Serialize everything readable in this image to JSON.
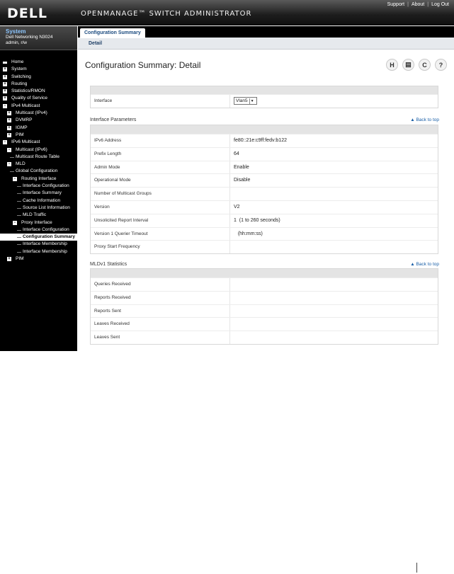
{
  "header": {
    "logo": "DELL",
    "product_title": "OPENMANAGE™ SWITCH ADMINISTRATOR",
    "links": [
      "Support",
      "About",
      "Log Out"
    ],
    "separator": "|"
  },
  "system": {
    "title": "System",
    "device": "Dell Networking N3024",
    "user": "admin, r/w"
  },
  "tree": [
    {
      "label": "Home",
      "level": 0,
      "expander": "",
      "icon": "home-icon"
    },
    {
      "label": "System",
      "level": 0,
      "expander": "+"
    },
    {
      "label": "Switching",
      "level": 0,
      "expander": "+"
    },
    {
      "label": "Routing",
      "level": 0,
      "expander": "+"
    },
    {
      "label": "Statistics/RMON",
      "level": 0,
      "expander": "+"
    },
    {
      "label": "Quality of Service",
      "level": 0,
      "expander": "+"
    },
    {
      "label": "IPv4 Multicast",
      "level": 0,
      "expander": "-"
    },
    {
      "label": "Multicast (IPv4)",
      "level": 1,
      "expander": "+"
    },
    {
      "label": "DVMRP",
      "level": 1,
      "expander": "+"
    },
    {
      "label": "IGMP",
      "level": 1,
      "expander": "+"
    },
    {
      "label": "PIM",
      "level": 1,
      "expander": "+"
    },
    {
      "label": "IPv6 Multicast",
      "level": 0,
      "expander": "-"
    },
    {
      "label": "Multicast (IPv6)",
      "level": 1,
      "expander": "-"
    },
    {
      "label": "Multicast Route Table",
      "level": 2,
      "expander": ""
    },
    {
      "label": "MLD",
      "level": 1,
      "expander": "-"
    },
    {
      "label": "Global Configuration",
      "level": 2,
      "expander": ""
    },
    {
      "label": "Routing Interface",
      "level": 2,
      "expander": "-"
    },
    {
      "label": "Interface Configuration",
      "level": 3,
      "expander": ""
    },
    {
      "label": "Interface Summary",
      "level": 3,
      "expander": ""
    },
    {
      "label": "Cache Information",
      "level": 3,
      "expander": ""
    },
    {
      "label": "Source List Information",
      "level": 3,
      "expander": ""
    },
    {
      "label": "MLD Traffic",
      "level": 3,
      "expander": ""
    },
    {
      "label": "Proxy Interface",
      "level": 2,
      "expander": "-"
    },
    {
      "label": "Interface Configuration",
      "level": 3,
      "expander": ""
    },
    {
      "label": "Configuration Summary",
      "level": 3,
      "expander": "",
      "selected": true
    },
    {
      "label": "Interface Membership",
      "level": 3,
      "expander": ""
    },
    {
      "label": "Interface Membership",
      "level": 3,
      "expander": ""
    },
    {
      "label": "PIM",
      "level": 1,
      "expander": "+"
    }
  ],
  "tabs": {
    "main": "Configuration Summary",
    "sub": "Detail"
  },
  "page_title": "Configuration Summary: Detail",
  "toolbar_icons": [
    {
      "name": "save-icon",
      "glyph": "H"
    },
    {
      "name": "print-icon",
      "glyph": "▤"
    },
    {
      "name": "refresh-icon",
      "glyph": "C"
    },
    {
      "name": "help-icon",
      "glyph": "?"
    }
  ],
  "interface_select": {
    "label": "Interface",
    "value": "Vlan5"
  },
  "interface_parameters": {
    "title": "Interface Parameters",
    "back_to_top": "Back to top",
    "rows": [
      {
        "label": "IPv6 Address",
        "value": "fe80::21e:c9ff:fedv:b122"
      },
      {
        "label": "Prefix Length",
        "value": "64"
      },
      {
        "label": "Admin Mode",
        "value": "Enable"
      },
      {
        "label": "Operational Mode",
        "value": "Disable"
      },
      {
        "label": "Number of Multicast Groups",
        "value": ""
      },
      {
        "label": "Version",
        "value": "V2"
      },
      {
        "label": "Unsolicited Report Interval",
        "value": "1  (1 to 260 seconds)"
      },
      {
        "label": "Version 1 Querier Timeout",
        "value": "   (hh:mm:ss)"
      },
      {
        "label": "Proxy Start Frequency",
        "value": ""
      }
    ]
  },
  "mldv1_statistics": {
    "title": "MLDv1 Statistics",
    "back_to_top": "Back to top",
    "rows": [
      {
        "label": "Queries Received",
        "value": ""
      },
      {
        "label": "Reports Received",
        "value": ""
      },
      {
        "label": "Reports Sent",
        "value": ""
      },
      {
        "label": "Leaves Received",
        "value": ""
      },
      {
        "label": "Leaves Sent",
        "value": ""
      }
    ]
  }
}
